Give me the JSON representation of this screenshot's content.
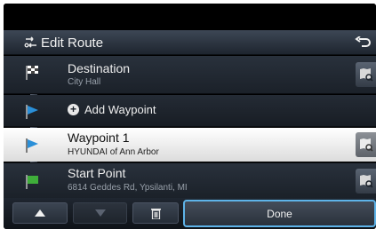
{
  "header": {
    "title": "Edit Route",
    "icons": {
      "route": "route-edit-icon",
      "back": "back-arrow-icon"
    }
  },
  "route": {
    "destination": {
      "title": "Destination",
      "subtitle": "City Hall",
      "icon": "checkered-flag-icon"
    },
    "add_waypoint": {
      "label": "Add Waypoint",
      "icon": "plus-circle-icon"
    },
    "waypoint1": {
      "title": "Waypoint 1",
      "subtitle": "HYUNDAI of Ann Arbor",
      "icon": "blue-flag-icon",
      "selected": true
    },
    "start": {
      "title": "Start Point",
      "subtitle": "6814 Geddes Rd, Ypsilanti, MI",
      "icon": "green-flag-icon"
    }
  },
  "toolbar": {
    "up_icon": "arrow-up-icon",
    "down_icon": "arrow-down-icon",
    "delete_icon": "trash-icon",
    "done_label": "Done"
  },
  "colors": {
    "accent": "#5eb3e8",
    "selected_row": "#ffffff",
    "waypoint_flag": "#2a8fd8",
    "start_flag": "#3fae3a"
  }
}
